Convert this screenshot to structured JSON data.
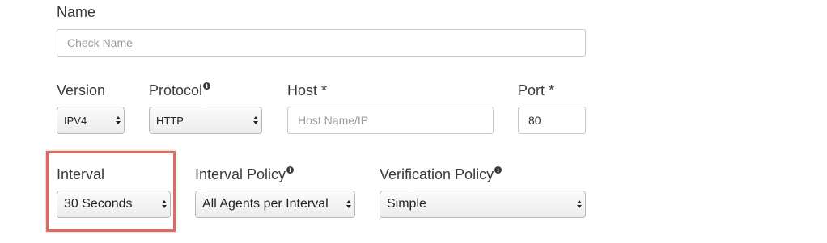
{
  "form": {
    "name": {
      "label": "Name",
      "placeholder": "Check Name",
      "value": ""
    },
    "version": {
      "label": "Version",
      "selected": "IPV4"
    },
    "protocol": {
      "label": "Protocol",
      "selected": "HTTP",
      "info_icon": "info-icon"
    },
    "host": {
      "label": "Host *",
      "placeholder": "Host Name/IP",
      "value": ""
    },
    "port": {
      "label": "Port *",
      "value": "80"
    },
    "interval": {
      "label": "Interval",
      "selected": "30 Seconds",
      "highlighted": true,
      "highlight_color": "#e2675c"
    },
    "interval_policy": {
      "label": "Interval Policy",
      "selected": "All Agents per Interval",
      "info_icon": "info-icon"
    },
    "verification_policy": {
      "label": "Verification Policy",
      "selected": "Simple",
      "info_icon": "info-icon"
    }
  }
}
